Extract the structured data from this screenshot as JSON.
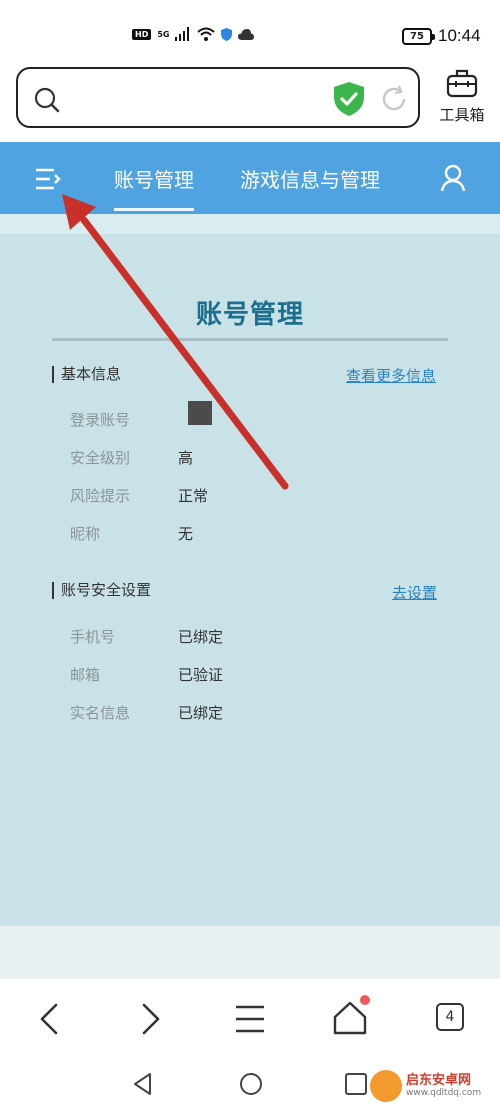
{
  "status_bar": {
    "hd": "HD",
    "network": "5G",
    "battery": "75",
    "time": "10:44"
  },
  "browser": {
    "search_value": "",
    "toolbox_label": "工具箱"
  },
  "nav": {
    "tab_account": "账号管理",
    "tab_game": "游戏信息与管理"
  },
  "page": {
    "title": "账号管理",
    "basic_section": {
      "heading": "基本信息",
      "link": "查看更多信息",
      "rows": [
        {
          "label": "登录账号",
          "value": ""
        },
        {
          "label": "安全级别",
          "value": "高"
        },
        {
          "label": "风险提示",
          "value": "正常"
        },
        {
          "label": "昵称",
          "value": "无"
        }
      ]
    },
    "security_section": {
      "heading": "账号安全设置",
      "link": "去设置",
      "rows": [
        {
          "label": "手机号",
          "value": "已绑定"
        },
        {
          "label": "邮箱",
          "value": "已验证"
        },
        {
          "label": "实名信息",
          "value": "已绑定"
        }
      ]
    }
  },
  "bottom_bar": {
    "tab_count": "4"
  },
  "watermark": {
    "name": "启东安卓网",
    "url": "www.qdltdq.com"
  },
  "colors": {
    "nav_blue": "#4ea3e0",
    "title_teal": "#1d6f8d",
    "link_blue": "#2a83c4",
    "arrow_red": "#c8312b",
    "shield_green": "#3cb54a"
  }
}
